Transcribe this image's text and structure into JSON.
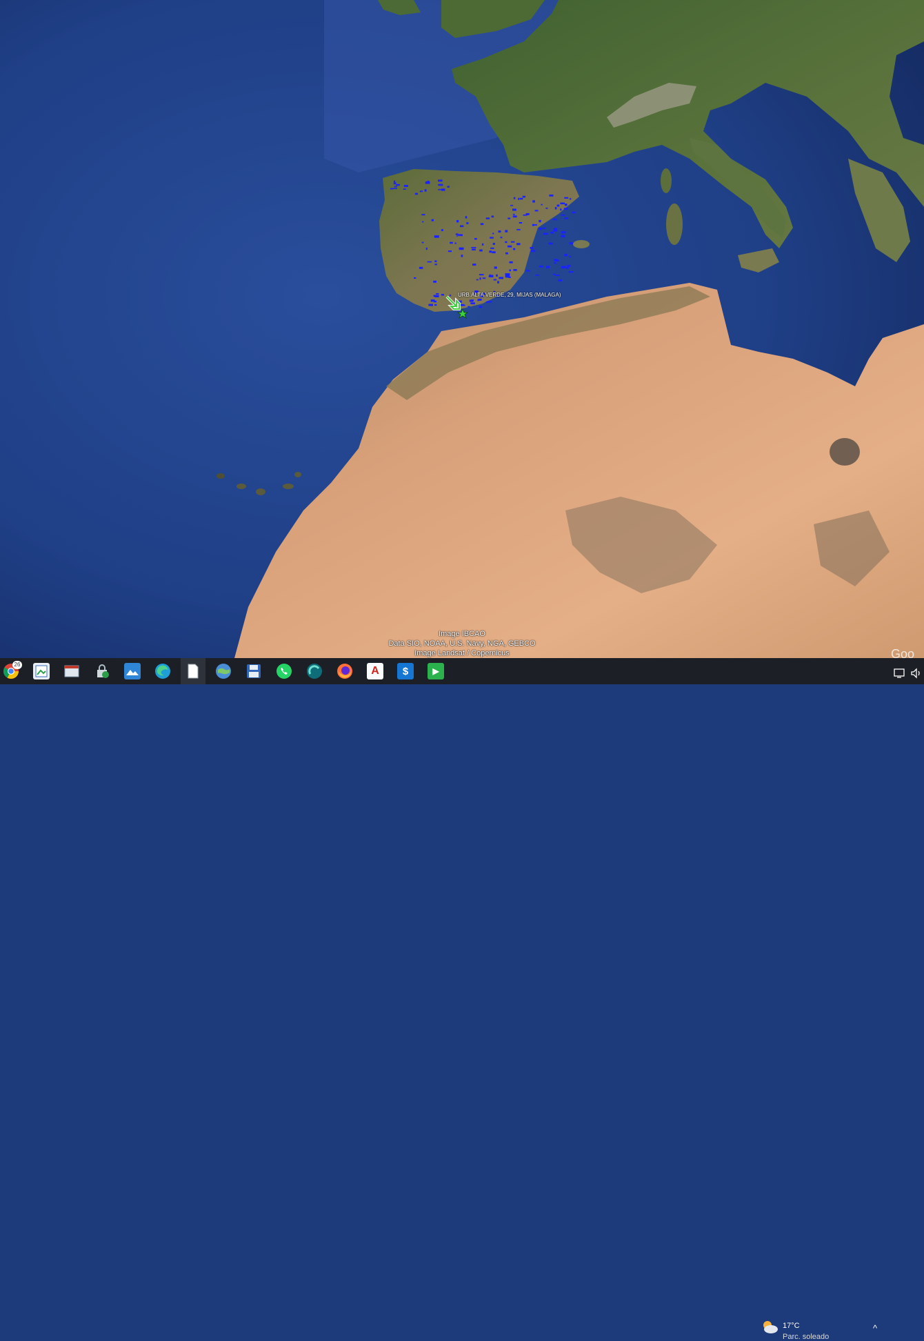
{
  "map": {
    "placemark": {
      "label": "URB.ALTA VERDE, 29, MIJAS (MALAGA)",
      "icon": "star-placemark-icon",
      "arrow": "arrow-pointer-icon"
    },
    "attribution": [
      "Image IBCAO",
      "Data SIO, NOAA, U.S. Navy, NGA, GEBCO",
      "Image Landsat / Copernicus"
    ],
    "logo": "Goo",
    "colors": {
      "ocean": "#1f3f86",
      "land_green": "#4f6b36",
      "desert": "#d9a17a",
      "markers": "#1a22ff",
      "placemark": "#3fd13f"
    }
  },
  "taskbar": {
    "apps": [
      {
        "name": "chrome-icon",
        "badge": "26"
      },
      {
        "name": "photo-viewer-icon"
      },
      {
        "name": "window-app-icon"
      },
      {
        "name": "security-app-icon"
      },
      {
        "name": "gallery-icon"
      },
      {
        "name": "edge-icon"
      },
      {
        "name": "document-icon",
        "active": true
      },
      {
        "name": "google-earth-icon"
      },
      {
        "name": "save-disk-icon"
      },
      {
        "name": "whatsapp-icon"
      },
      {
        "name": "signal-app-icon"
      },
      {
        "name": "firefox-icon"
      },
      {
        "name": "acrobat-icon",
        "glyph": "A"
      },
      {
        "name": "dollar-app-icon",
        "glyph": "$"
      },
      {
        "name": "media-player-icon",
        "glyph": "▶"
      }
    ],
    "weather": {
      "temperature": "17°C",
      "description": "Parc. soleado",
      "icon": "partly-sunny-icon"
    },
    "tray": {
      "chevron": "^",
      "icons": [
        "network-icon",
        "volume-icon"
      ]
    }
  }
}
